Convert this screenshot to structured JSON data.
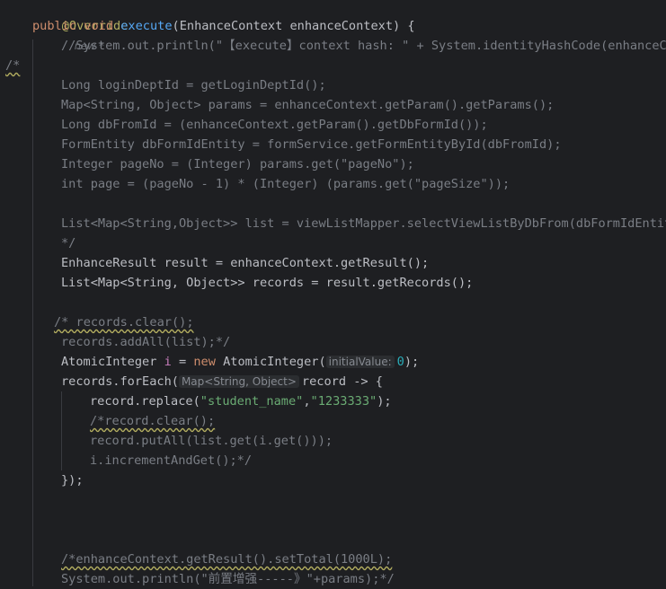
{
  "editor": {
    "annotation": "@Override",
    "new_marker": "new *",
    "lines": {
      "l1_kw": "public void ",
      "l1_fn": "execute",
      "l1_rest": "(EnhanceContext enhanceContext) {",
      "l2": "//System.out.println(\"【execute】context hash: \" + System.identityHashCode(enhanceCon",
      "l3": "/*",
      "l4": "Long loginDeptId = getLoginDeptId();",
      "l5": "Map<String, Object> params = enhanceContext.getParam().getParams();",
      "l6": "Long dbFromId = (enhanceContext.getParam().getDbFormId());",
      "l7": "FormEntity dbFormIdEntity = formService.getFormEntityById(dbFromId);",
      "l8": "Integer pageNo = (Integer) params.get(\"pageNo\");",
      "l9": "int page = (pageNo - 1) * (Integer) (params.get(\"pageSize\"));",
      "l10": "List<Map<String,Object>> list = viewListMapper.selectViewListByDbFrom(dbFormIdEntity",
      "l11": "*/",
      "l12": "EnhanceResult result = enhanceContext.getResult();",
      "l13": "List<Map<String, Object>> records = result.getRecords();",
      "l14": "/* records.clear();",
      "l15": "records.addAll(list);*/",
      "l16_a": "AtomicInteger ",
      "l16_var": "i",
      "l16_b": " = ",
      "l16_kw": "new",
      "l16_c": " AtomicInteger(",
      "l16_hint": "initialValue:",
      "l16_num": "0",
      "l16_d": ");",
      "l17_a": "records.forEach(",
      "l17_hint": "Map<String, Object>",
      "l17_b": "record -> {",
      "l18_a": "record.replace(",
      "l18_s1": "\"student_name\"",
      "l18_comma": ",",
      "l18_s2": "\"1233333\"",
      "l18_b": ");",
      "l19": "/*record.clear();",
      "l20": "record.putAll(list.get(i.get()));",
      "l21": "i.incrementAndGet();*/",
      "l22": "});",
      "l23": "/*enhanceContext.getResult().setTotal(1000L);",
      "l24": "System.out.println(\"前置增强-----》\"+params);*/"
    }
  }
}
